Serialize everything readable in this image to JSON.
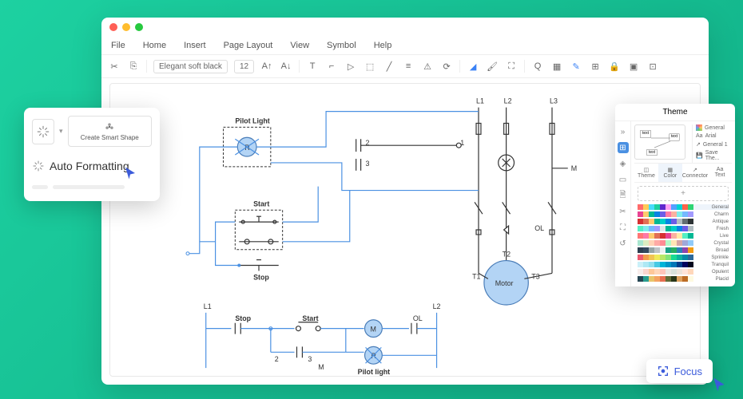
{
  "menubar": [
    "File",
    "Home",
    "Insert",
    "Page Layout",
    "View",
    "Symbol",
    "Help"
  ],
  "toolbar": {
    "font": "Elegant soft black",
    "size": "12"
  },
  "canvas": {
    "pilot_light": "Pilot Light",
    "pilot_light_r": "R",
    "start": "Start",
    "stop": "Stop",
    "l1": "L1",
    "l2": "L2",
    "l3": "L3",
    "m": "M",
    "ol": "OL",
    "t1": "T1",
    "t2": "T2",
    "t3": "T3",
    "motor": "Motor",
    "n2": "2",
    "n3": "3",
    "n1": "1",
    "bottom": {
      "l1": "L1",
      "l2": "L2",
      "stop": "Stop",
      "start": "Start",
      "ol": "OL",
      "m": "M",
      "pilot": "Pilot light",
      "r": "R",
      "n2": "2",
      "n3": "3"
    }
  },
  "card_af": {
    "create_smart": "Create Smart Shape",
    "auto_format": "Auto Formatting"
  },
  "theme": {
    "title": "Theme",
    "opts": [
      "General",
      "Arial",
      "General 1",
      "Save The..."
    ],
    "tabs": [
      "Theme",
      "Color",
      "Connector",
      "Text"
    ],
    "palettes": [
      "General",
      "Charm",
      "Antique",
      "Fresh",
      "Live",
      "Crystal",
      "Broad",
      "Sprinkle",
      "Tranquil",
      "Opulent",
      "Placid"
    ]
  },
  "focus": "Focus",
  "palette_colors": [
    [
      "#ff6b6b",
      "#feca57",
      "#48dbfb",
      "#1dd1a1",
      "#5f27cd",
      "#ff9ff3",
      "#54a0ff",
      "#00d2d3",
      "#ff6348",
      "#2ed573"
    ],
    [
      "#e84393",
      "#fdcb6e",
      "#00b894",
      "#0984e3",
      "#6c5ce7",
      "#fd79a8",
      "#fab1a0",
      "#81ecec",
      "#74b9ff",
      "#a29bfe"
    ],
    [
      "#d63031",
      "#e17055",
      "#fdcb6e",
      "#00b894",
      "#00cec9",
      "#0984e3",
      "#6c5ce7",
      "#b2bec3",
      "#636e72",
      "#2d3436"
    ],
    [
      "#55efc4",
      "#81ecec",
      "#74b9ff",
      "#a29bfe",
      "#dfe6e9",
      "#00b894",
      "#00cec9",
      "#0984e3",
      "#6c5ce7",
      "#b2bec3"
    ],
    [
      "#ff7675",
      "#fd79a8",
      "#fdcb6e",
      "#e17055",
      "#d63031",
      "#e84393",
      "#fab1a0",
      "#ffeaa7",
      "#55efc4",
      "#00b894"
    ],
    [
      "#a8e6cf",
      "#dcedc1",
      "#ffd3b6",
      "#ffaaa5",
      "#ff8b94",
      "#b4f8c8",
      "#ffe5b4",
      "#d4a5a5",
      "#9fa8da",
      "#90caf9"
    ],
    [
      "#2c3e50",
      "#34495e",
      "#95a5a6",
      "#bdc3c7",
      "#ecf0f1",
      "#16a085",
      "#27ae60",
      "#2980b9",
      "#8e44ad",
      "#f39c12"
    ],
    [
      "#ee5a6f",
      "#f29e4c",
      "#f1c453",
      "#efea5a",
      "#b9e769",
      "#83e377",
      "#16db93",
      "#0db39e",
      "#048ba8",
      "#2c699a"
    ],
    [
      "#caf0f8",
      "#ade8f4",
      "#90e0ef",
      "#48cae4",
      "#00b4d8",
      "#0096c7",
      "#0077b6",
      "#023e8a",
      "#03045e",
      "#03071e"
    ],
    [
      "#f8edeb",
      "#fcd5ce",
      "#fec89a",
      "#ffd7ba",
      "#fec5bb",
      "#e8e8e4",
      "#d8e2dc",
      "#ece4db",
      "#ffe5d9",
      "#ffd7ba"
    ],
    [
      "#264653",
      "#2a9d8f",
      "#e9c46a",
      "#f4a261",
      "#e76f51",
      "#606c38",
      "#283618",
      "#dda15e",
      "#bc6c25",
      "#fefae0"
    ]
  ]
}
